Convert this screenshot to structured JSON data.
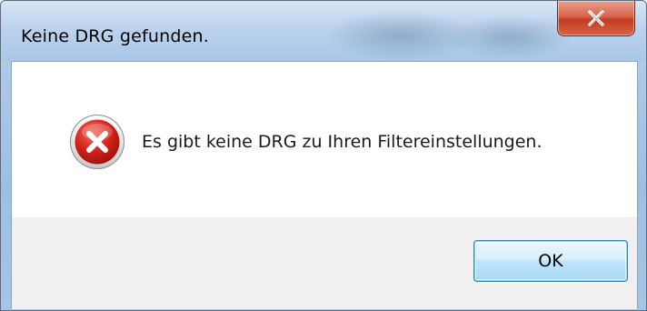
{
  "window": {
    "title": "Keine DRG gefunden."
  },
  "titlebar": {
    "close_icon": "close-icon"
  },
  "dialog": {
    "icon": "error-icon",
    "message": "Es gibt keine DRG zu Ihren Filtereinstellungen."
  },
  "buttons": {
    "ok_label": "OK"
  },
  "colors": {
    "error_red": "#c8201c",
    "close_red": "#c23b22",
    "ok_border": "#3c7fb1"
  }
}
